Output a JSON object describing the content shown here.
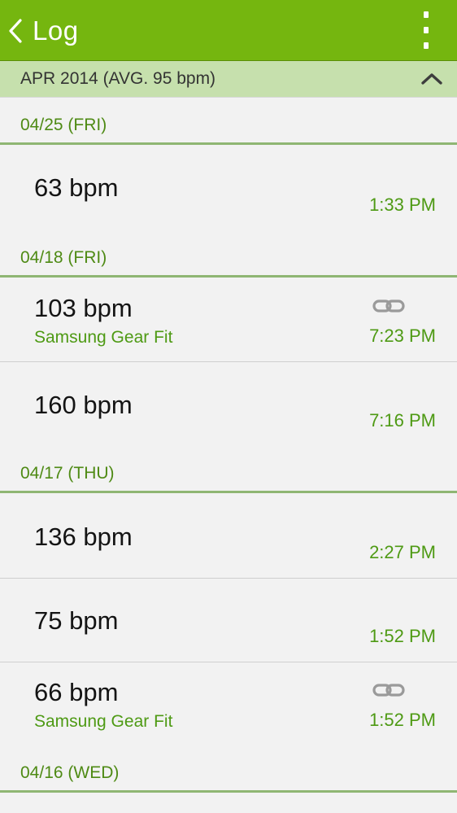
{
  "app_bar": {
    "title": "Log"
  },
  "month_header": {
    "label": "APR 2014 (AVG. 95 bpm)"
  },
  "groups": [
    {
      "date": "04/25 (FRI)",
      "entries": [
        {
          "bpm": "63 bpm",
          "time": "1:33 PM",
          "device": ""
        }
      ]
    },
    {
      "date": "04/18 (FRI)",
      "entries": [
        {
          "bpm": "103 bpm",
          "time": "7:23 PM",
          "device": "Samsung Gear Fit",
          "icon": "link-icon"
        },
        {
          "bpm": "160 bpm",
          "time": "7:16 PM",
          "device": ""
        }
      ]
    },
    {
      "date": "04/17 (THU)",
      "entries": [
        {
          "bpm": "136 bpm",
          "time": "2:27 PM",
          "device": ""
        },
        {
          "bpm": "75 bpm",
          "time": "1:52 PM",
          "device": ""
        },
        {
          "bpm": "66 bpm",
          "time": "1:52 PM",
          "device": "Samsung Gear Fit",
          "icon": "link-icon"
        }
      ]
    },
    {
      "date": "04/16 (WED)",
      "entries": []
    }
  ],
  "colors": {
    "accent": "#75b60f",
    "month_bg": "#c6e0ad",
    "text_green": "#4e9a14"
  }
}
